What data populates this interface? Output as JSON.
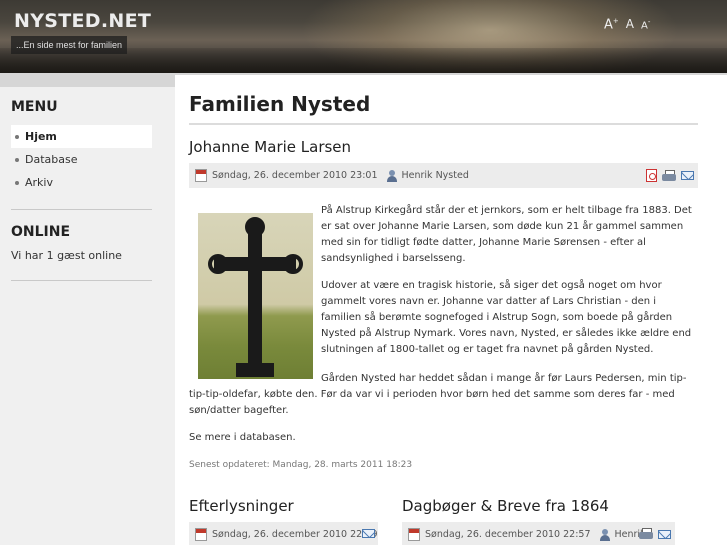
{
  "header": {
    "site_title": "NYSTED.NET",
    "slogan": "...En side mest for familien",
    "font_large": "A",
    "font_large_sup": "+",
    "font_normal": "A",
    "font_small": "A",
    "font_small_sup": "-"
  },
  "sidebar": {
    "menu_heading": "MENU",
    "menu_items": [
      {
        "label": "Hjem",
        "active": true
      },
      {
        "label": "Database",
        "active": false
      },
      {
        "label": "Arkiv",
        "active": false
      }
    ],
    "online_heading": "ONLINE",
    "online_text": "Vi har 1 gæst online"
  },
  "main": {
    "page_title": "Familien Nysted",
    "article": {
      "title": "Johanne Marie Larsen",
      "date": "Søndag, 26. december 2010 23:01",
      "author": "Henrik Nysted",
      "paragraph1": "På Alstrup Kirkegård står der et jernkors, som er helt tilbage fra 1883. Det er sat over Johanne Marie Larsen, som døde kun 21 år gammel sammen med sin for tidligt fødte datter, Johanne Marie Sørensen - efter al sandsynlighed i barselsseng.",
      "paragraph2": "Udover at være en tragisk historie, så siger det også noget om hvor gammelt vores navn er. Johanne var datter af Lars Christian - den i familien så berømte sognefoged i Alstrup Sogn, som boede på gården Nysted på Alstrup Nymark. Vores navn, Nysted, er således ikke ældre end slutningen af 1800-tallet og er taget fra navnet på gården Nysted.",
      "paragraph3": "Gården Nysted har heddet sådan i mange år før Laurs Pedersen, min tip-tip-tip-oldefar, købte den. Før da var vi i perioden hvor børn hed det samme som deres far - med søn/datter bagefter.",
      "paragraph4": "Se mere i databasen.",
      "updated": "Senest opdateret: Mandag, 28. marts 2011 18:23"
    },
    "teasers": [
      {
        "title": "Efterlysninger",
        "date": "Søndag, 26. december 2010 22:59"
      },
      {
        "title": "Dagbøger & Breve fra 1864",
        "date": "Søndag, 26. december 2010 22:57",
        "author": "Henrik"
      }
    ]
  },
  "colors": {
    "header_dark": "#3d3a34",
    "sidebar_bg": "#f0f0f0",
    "meta_bg": "#ececec"
  }
}
